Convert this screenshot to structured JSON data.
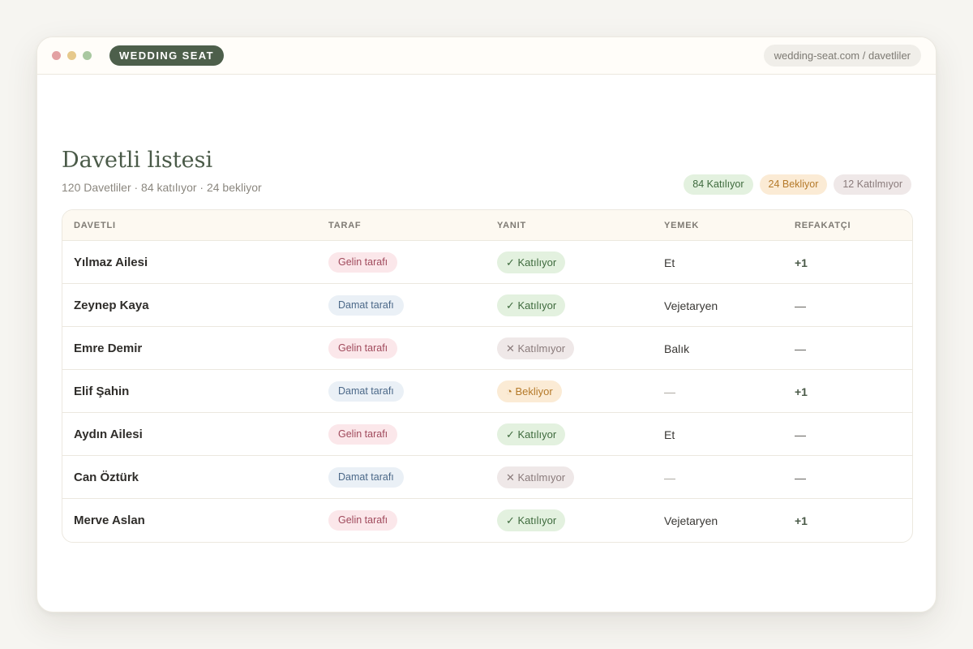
{
  "window": {
    "brand": "WEDDING SEAT",
    "url": "wedding-seat.com / davetliler"
  },
  "header": {
    "title": "Davetli listesi",
    "subtitle": "120 Davetliler · 84 katılıyor · 24 bekliyor"
  },
  "summary": {
    "attending": "84 Katılıyor",
    "pending": "24 Bekliyor",
    "declined": "12 Katılmıyor"
  },
  "table": {
    "columns": [
      "DAVETLI",
      "TARAF",
      "YANIT",
      "YEMEK",
      "REFAKATÇI"
    ],
    "rows": [
      {
        "name": "Yılmaz Ailesi",
        "side": "Gelin tarafı",
        "side_type": "bride",
        "reply": "✓ Katılıyor",
        "reply_type": "yes",
        "meal": "Et",
        "plus": "+1"
      },
      {
        "name": "Zeynep Kaya",
        "side": "Damat tarafı",
        "side_type": "groom",
        "reply": "✓ Katılıyor",
        "reply_type": "yes",
        "meal": "Vejetaryen",
        "plus": "—"
      },
      {
        "name": "Emre Demir",
        "side": "Gelin tarafı",
        "side_type": "bride",
        "reply": "✕ Katılmıyor",
        "reply_type": "no",
        "meal": "Balık",
        "plus": "—"
      },
      {
        "name": "Elif Şahin",
        "side": "Damat tarafı",
        "side_type": "groom",
        "reply": "◔ Bekliyor",
        "reply_type": "wait",
        "meal": "—",
        "plus": "+1"
      },
      {
        "name": "Aydın Ailesi",
        "side": "Gelin tarafı",
        "side_type": "bride",
        "reply": "✓ Katılıyor",
        "reply_type": "yes",
        "meal": "Et",
        "plus": "—"
      },
      {
        "name": "Can Öztürk",
        "side": "Damat tarafı",
        "side_type": "groom",
        "reply": "✕ Katılmıyor",
        "reply_type": "no",
        "meal": "—",
        "plus": "—"
      },
      {
        "name": "Merve Aslan",
        "side": "Gelin tarafı",
        "side_type": "bride",
        "reply": "✓ Katılıyor",
        "reply_type": "yes",
        "meal": "Vejetaryen",
        "plus": "+1"
      }
    ]
  },
  "colors": {
    "brand": "#4d5f4b",
    "attending": "#3f6b3e",
    "pending": "#b57a2a",
    "declined": "#8a7b7b"
  }
}
